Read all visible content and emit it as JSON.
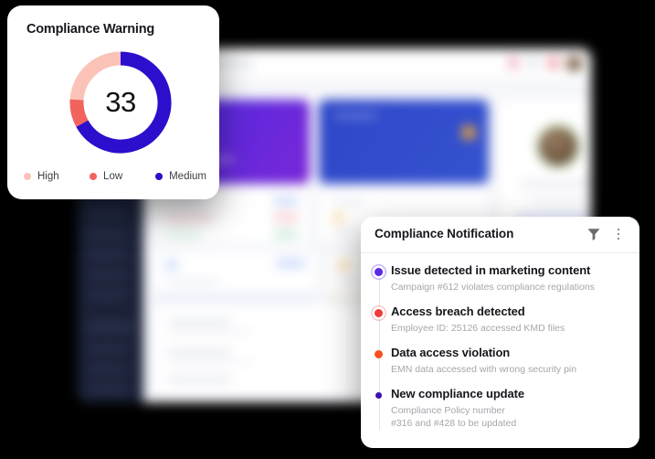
{
  "warning_card": {
    "title": "Compliance Warning",
    "value": "33",
    "legend": [
      {
        "label": "High",
        "color": "#fbc3b8"
      },
      {
        "label": "Low",
        "color": "#f2635e"
      },
      {
        "label": "Medium",
        "color": "#2b0fcc"
      }
    ]
  },
  "chart_data": {
    "type": "pie",
    "title": "Compliance Warning",
    "center_label": "33",
    "categories": [
      "Medium",
      "Low",
      "High"
    ],
    "values": [
      67,
      9,
      24
    ],
    "colors": [
      "#2b0fcc",
      "#f2635e",
      "#fbc3b8"
    ],
    "legend_position": "bottom",
    "donut": true,
    "legend_order": [
      "High",
      "Low",
      "Medium"
    ]
  },
  "notification_panel": {
    "title": "Compliance Notification",
    "filter_icon": "filter-funnel-icon",
    "menu_icon": "more-vertical-icon",
    "items": [
      {
        "title": "Issue detected in marketing content",
        "subtitle": "Campaign #612 violates compliance regulations",
        "dot_color": "#5a28e6",
        "dot_style": "ring"
      },
      {
        "title": "Access breach detected",
        "subtitle": "Employee ID: 25126 accessed KMD files",
        "dot_color": "#ef3b3b",
        "dot_style": "ring-red"
      },
      {
        "title": "Data access violation",
        "subtitle": "EMN data accessed with wrong security pin",
        "dot_color": "#f4511e",
        "dot_style": "plain"
      },
      {
        "title": "New compliance update",
        "subtitle": "Compliance Policy number\n#316 and #428 to be updated",
        "dot_color": "#3b0fb0",
        "dot_style": "small"
      }
    ]
  },
  "dashboard": {
    "sidebar_color": "#1b2238",
    "surface_color": "#f6f7fb",
    "accent_purple": "#4a2ae0",
    "accent_blue": "#2d46c8"
  }
}
